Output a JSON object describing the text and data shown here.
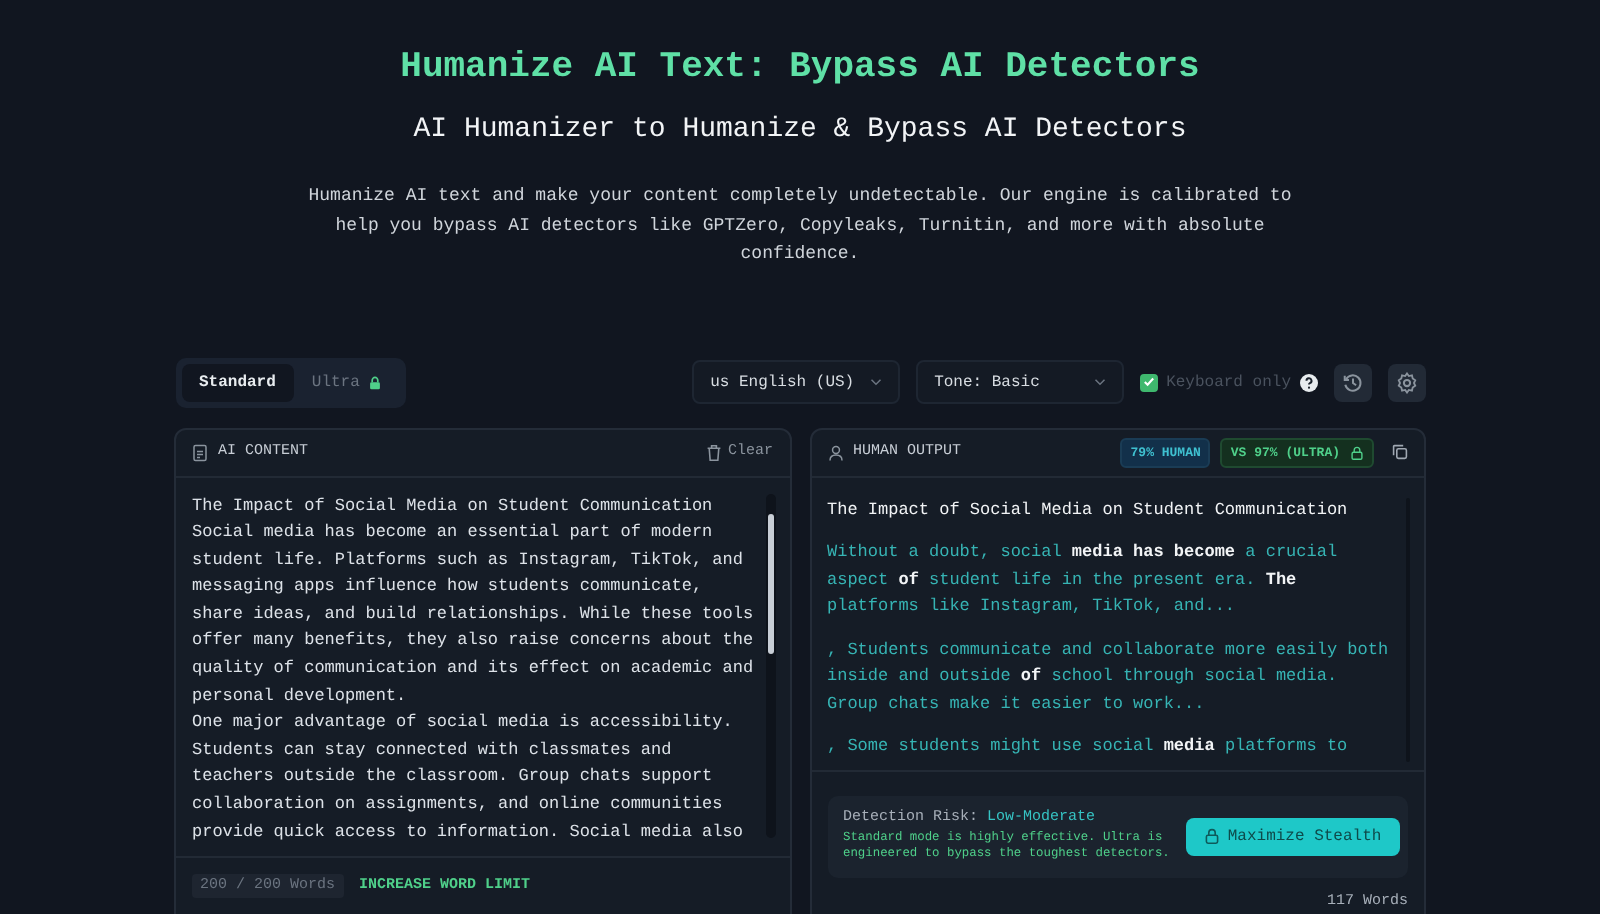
{
  "header": {
    "title": "Humanize AI Text: Bypass AI Detectors",
    "subtitle": "AI Humanizer to Humanize & Bypass AI Detectors",
    "description": "Humanize AI text and make your content completely undetectable. Our engine is calibrated to help you bypass AI detectors like GPTZero, Copyleaks, Turnitin, and more with absolute confidence."
  },
  "mode_tabs": [
    {
      "label": "Standard",
      "selected": true,
      "locked": false
    },
    {
      "label": "Ultra",
      "selected": false,
      "locked": true
    }
  ],
  "language_select": {
    "value": "us English (US)"
  },
  "tone_select": {
    "value": "Tone: Basic"
  },
  "keyboard_only": {
    "label": "Keyboard only",
    "checked": true
  },
  "input_panel": {
    "title": "AI CONTENT",
    "clear_label": "Clear",
    "lines": [
      "The Impact of Social Media on Student Communication",
      "Social media has become an essential part of modern",
      "student life. Platforms such as Instagram, TikTok, and",
      "messaging apps influence how students communicate,",
      "share ideas, and build relationships. While these tools",
      "offer many benefits, they also raise concerns about the",
      "quality of communication and its effect on academic and",
      "personal development.",
      "One major advantage of social media is accessibility.",
      "Students can stay connected with classmates and",
      "teachers outside the classroom. Group chats support",
      "collaboration on assignments, and online communities",
      "provide quick access to information. Social media also"
    ],
    "word_count": "200 / 200 Words",
    "upgrade_link": "INCREASE WORD LIMIT"
  },
  "output_panel": {
    "title": "HUMAN OUTPUT",
    "badges": [
      {
        "label": "79% HUMAN",
        "kind": "score"
      },
      {
        "label": "VS 97% (ULTRA)",
        "kind": "locked"
      }
    ],
    "heading": "The Impact of Social Media on Student Communication",
    "paragraphs": [
      {
        "segments": [
          {
            "text": "Without a doubt, social ",
            "changed": true
          },
          {
            "text": "media has become ",
            "changed": false
          },
          {
            "text": "a crucial aspect ",
            "changed": true
          },
          {
            "text": "of ",
            "changed": false
          },
          {
            "text": "student life in the present era. ",
            "changed": true
          },
          {
            "text": "The ",
            "changed": false
          },
          {
            "text": "platforms like Instagram, TikTok, and...",
            "changed": true
          }
        ]
      },
      {
        "segments": [
          {
            "text": ", Students communicate and collaborate more easily both inside and outside ",
            "changed": true
          },
          {
            "text": "of ",
            "changed": false
          },
          {
            "text": "school through social media. Group chats make it easier to work...",
            "changed": true
          }
        ]
      },
      {
        "segments": [
          {
            "text": ", Some students might use social ",
            "changed": true
          },
          {
            "text": "media ",
            "changed": false
          },
          {
            "text": "platforms to",
            "changed": true
          }
        ]
      }
    ],
    "detection": {
      "label": "Detection Risk:",
      "value": "Low-Moderate",
      "note": "Standard mode is highly effective. Ultra is engineered to bypass the toughest detectors.",
      "button": "Maximize Stealth"
    },
    "word_count": "117 Words"
  }
}
